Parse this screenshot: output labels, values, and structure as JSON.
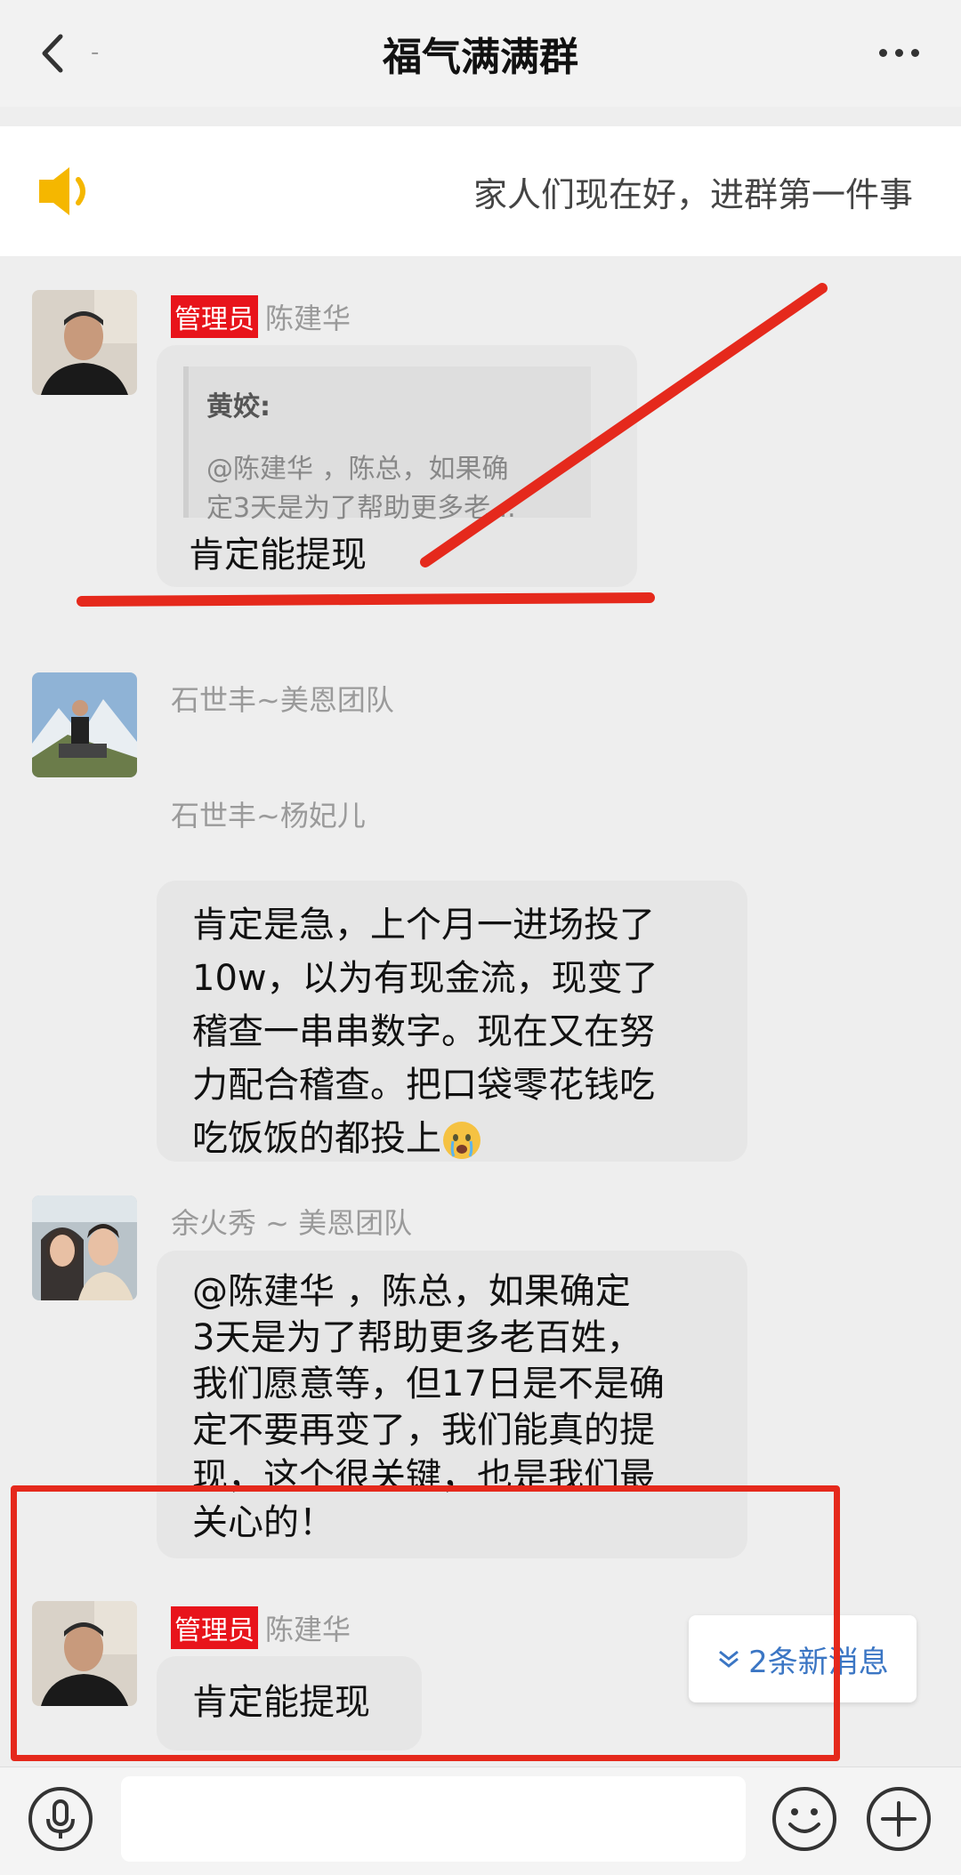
{
  "header": {
    "title": "福气满满群",
    "back_dash": "-"
  },
  "announcement": {
    "text": "家人们现在好，进群第一件事"
  },
  "messages": [
    {
      "badge": "管理员",
      "sender": "陈建华",
      "quote_author": "黄姣:",
      "quote_text_line1": "@陈建华 ，陈总，如果确",
      "quote_text_line2": "定3天是为了帮助更多老...",
      "text": "肯定能提现"
    },
    {
      "sender": "石世丰~美恩团队"
    },
    {
      "sender": "石世丰~杨妃儿",
      "lines": [
        "肯定是急，上个月一进场投了",
        "10w，以为有现金流，现变了",
        "稽查一串串数字。现在又在努",
        "力配合稽查。把口袋零花钱吃",
        "吃饭饭的都投上"
      ],
      "emoji": "crying-emoji"
    },
    {
      "sender": "余火秀 ~ 美恩团队",
      "lines": [
        "@陈建华 ，陈总，如果确定",
        "3天是为了帮助更多老百姓，",
        "我们愿意等，但17日是不是确",
        "定不要再变了，我们能真的提",
        "现，这个很关键，也是我们最",
        "关心的！"
      ]
    },
    {
      "badge": "管理员",
      "sender": "陈建华",
      "text": "肯定能提现"
    }
  ],
  "new_messages": {
    "label": "2条新消息",
    "icon": "double-chevron-down-icon"
  },
  "input": {
    "placeholder": "",
    "value": ""
  },
  "colors": {
    "admin_badge": "#e8141b",
    "annotation_red": "#e5291c",
    "bubble": "#e6e6e6",
    "link_blue": "#3b76c4",
    "speaker_yellow": "#f5b700"
  }
}
